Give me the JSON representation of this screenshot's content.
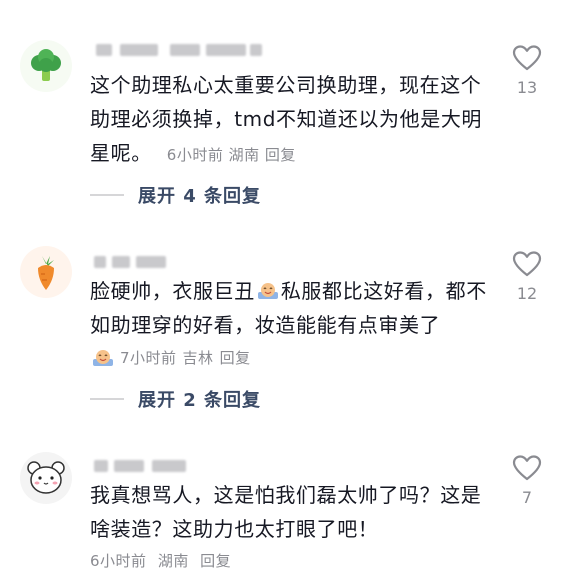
{
  "comments": [
    {
      "text": "这个助理私心太重要公司换助理，现在这个助理必须换掉，tmd不知道还以为他是大明星呢。",
      "time": "6小时前",
      "region": "湖南",
      "reply": "回复",
      "likes": "13",
      "expand": "展开 4 条回复",
      "avatar_icon": "broccoli-icon"
    },
    {
      "text_part1": "脸硬帅，衣服巨丑",
      "text_part2": "私服都比这好看，都不如助理穿的好看，妆造能能有点审美了",
      "time": "7小时前",
      "region": "吉林",
      "reply": "回复",
      "likes": "12",
      "expand": "展开 2 条回复",
      "avatar_icon": "carrot-icon"
    },
    {
      "text": "我真想骂人，这是怕我们磊太帅了吗？这是啥装造？这助力也太打眼了吧！",
      "time": "6小时前",
      "region": "湖南",
      "reply": "回复",
      "likes": "7",
      "avatar_icon": "bear-icon"
    }
  ]
}
